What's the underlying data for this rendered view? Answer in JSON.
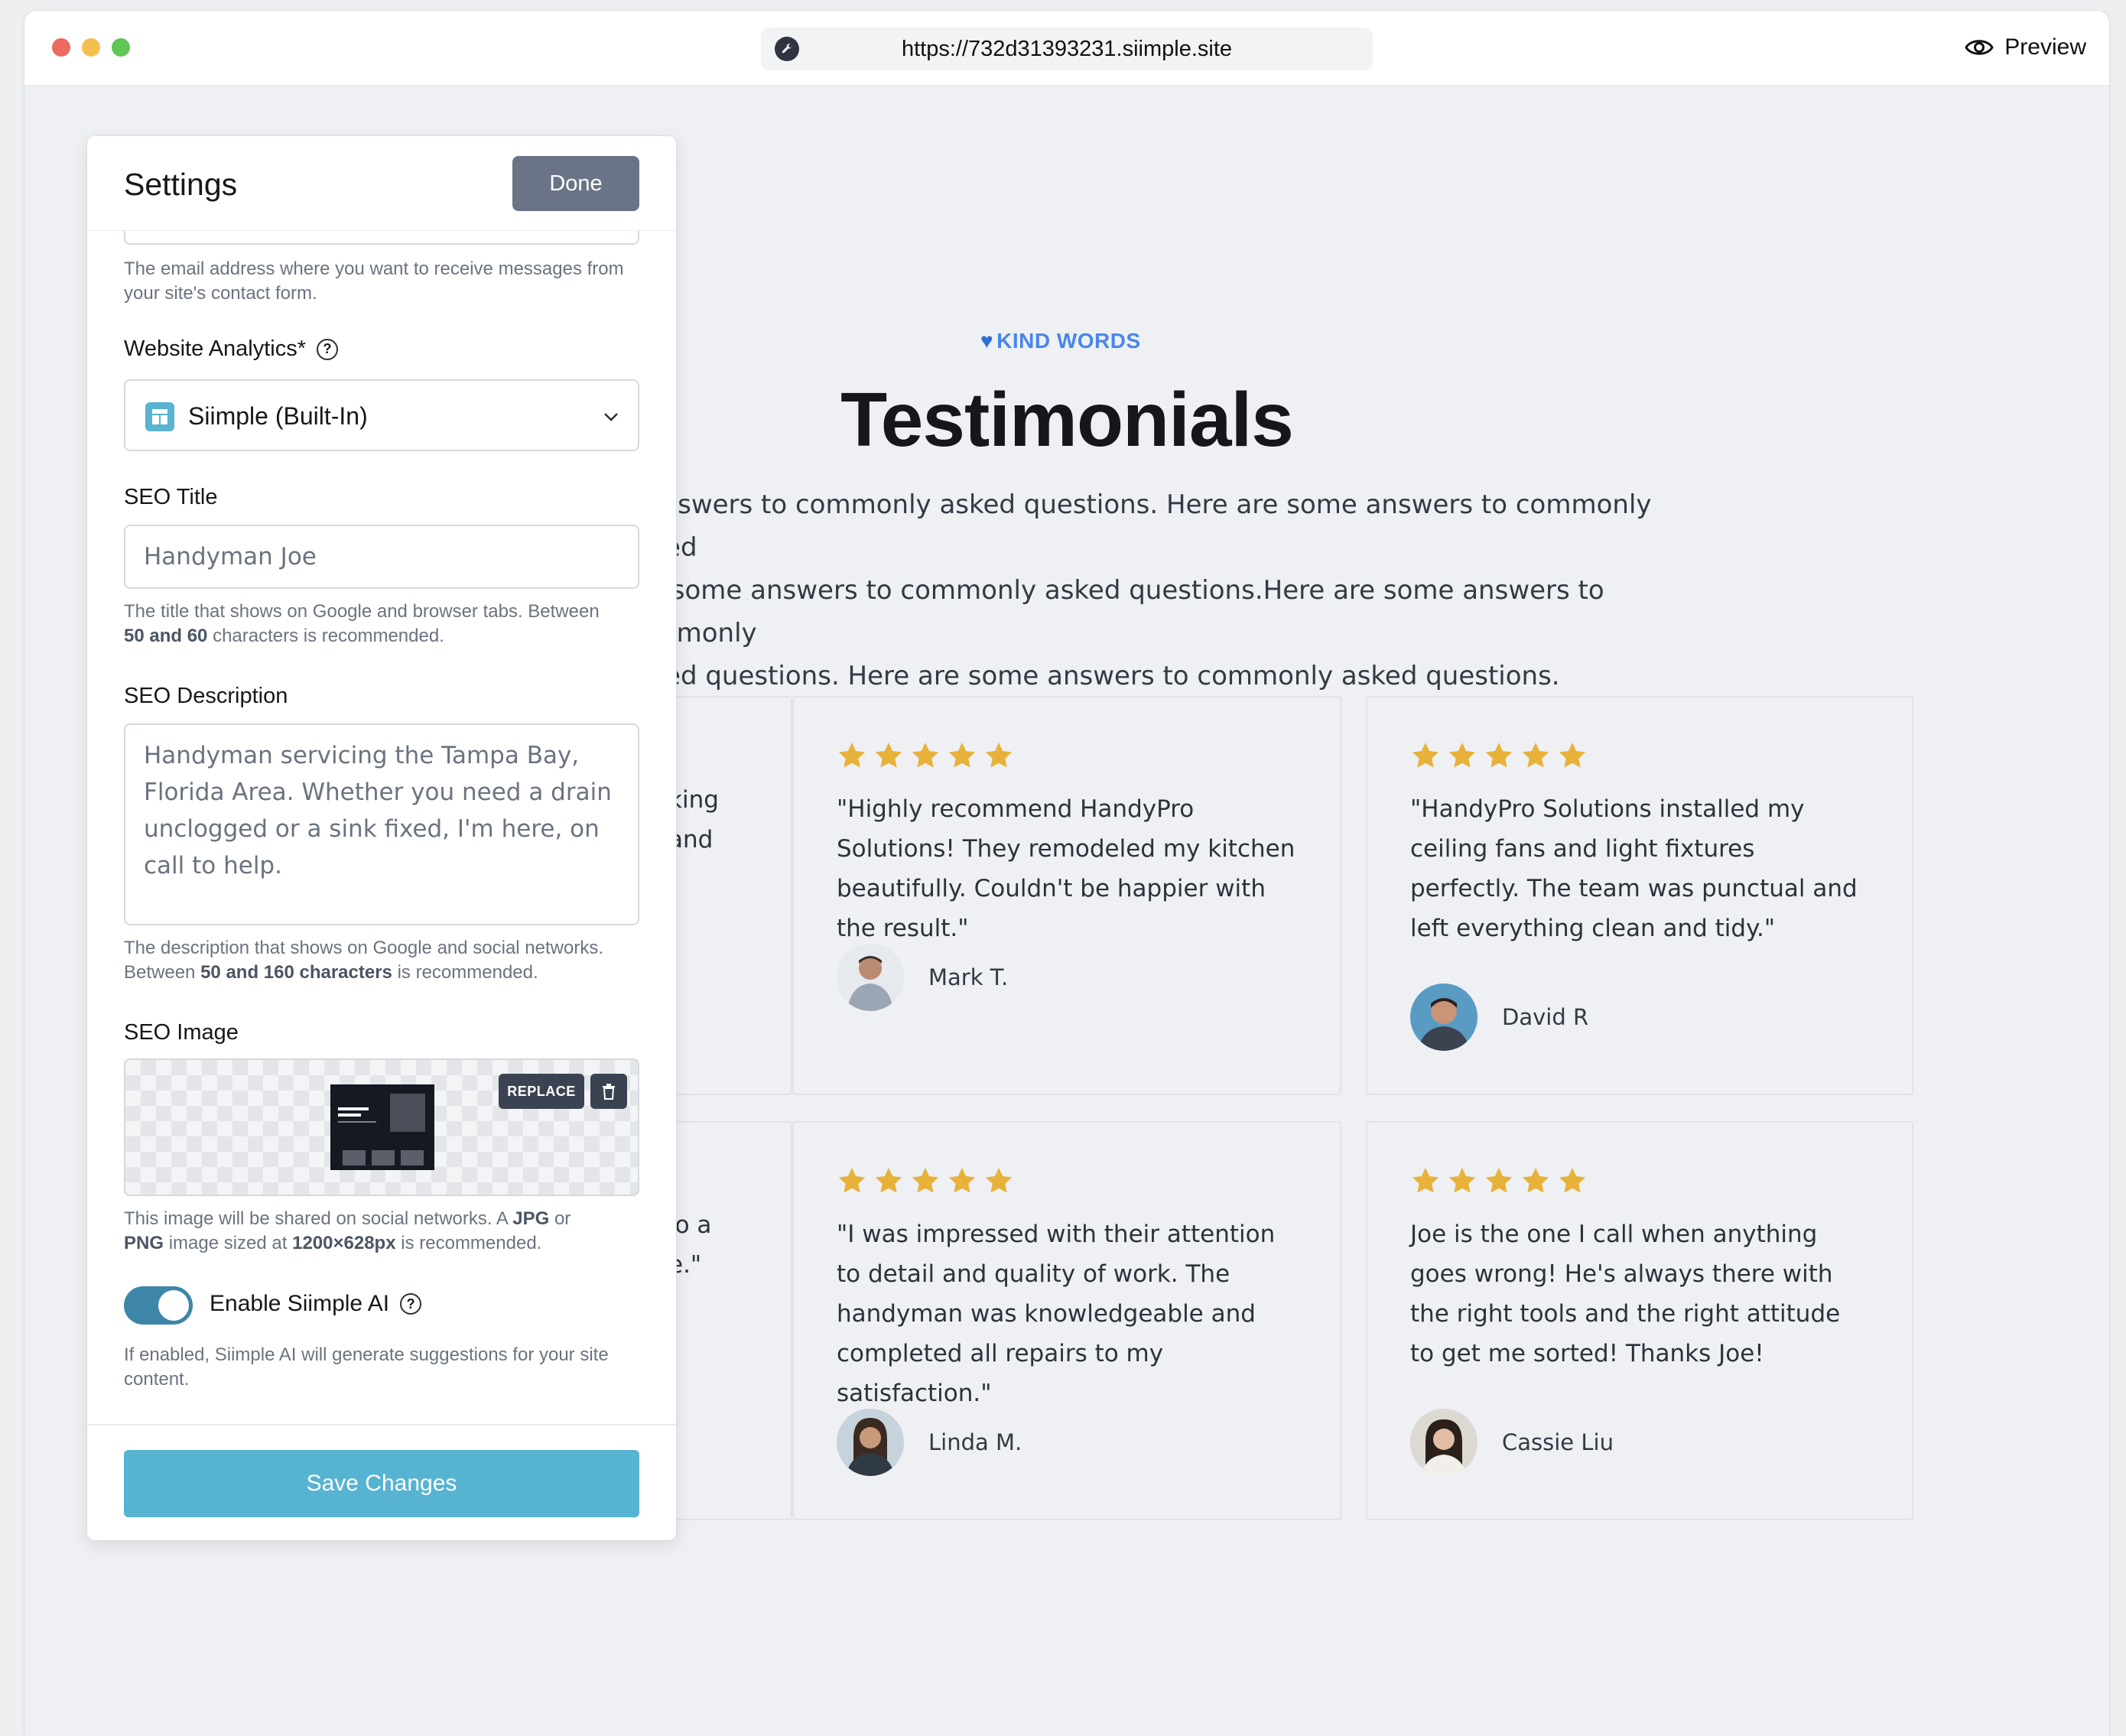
{
  "browser": {
    "url": "https://732d31393231.siimple.site",
    "preview_label": "Preview"
  },
  "settings": {
    "title": "Settings",
    "done_label": "Done",
    "email_help": "The email address where you want to receive messages from your site's contact form.",
    "analytics_label": "Website Analytics*",
    "analytics_value": "Siimple (Built-In)",
    "seo_title_label": "SEO Title",
    "seo_title_value": "Handyman Joe",
    "seo_title_help_1": "The title that shows on Google and browser tabs. Between",
    "seo_title_help_bold": "50 and 60",
    "seo_title_help_2": "characters is recommended.",
    "seo_desc_label": "SEO Description",
    "seo_desc_value": "Handyman servicing the Tampa Bay, Florida Area. Whether you need a drain unclogged or a sink fixed, I'm here, on call to help.",
    "seo_desc_help_1": "The description that shows on Google and social networks. Between",
    "seo_desc_help_bold": "50 and 160 characters",
    "seo_desc_help_2": "is recommended.",
    "seo_image_label": "SEO Image",
    "replace_label": "REPLACE",
    "image_help_1": "This image will be shared on social networks. A",
    "image_help_jpg": "JPG",
    "image_help_or": "or",
    "image_help_png": "PNG",
    "image_help_2": "image sized at",
    "image_help_size": "1200×628px",
    "image_help_3": "is recommended.",
    "ai_label": "Enable Siimple AI",
    "ai_enabled": true,
    "ai_help": "If enabled, Siimple AI will generate suggestions for your site content.",
    "save_label": "Save Changes"
  },
  "page": {
    "eyebrow": "KIND WORDS",
    "eyebrow_icon": "blue-heart-icon",
    "headline": "Testimonials",
    "intro_lines": [
      "e answers to commonly asked questions. Here are some answers to commonly asked",
      "are some answers to commonly asked questions.Here are some answers to commonly",
      "asked questions. Here are some answers to commonly asked questions."
    ],
    "partial_card_1": [
      "king",
      "and"
    ],
    "partial_card_2": [
      "lo a",
      "e.\""
    ],
    "star_color": "#e8b23a",
    "testimonials": [
      {
        "rating": 5,
        "quote": "\"Highly recommend HandyPro Solutions! They remodeled my kitchen beautifully. Couldn't be happier with the result.\"",
        "name": "Mark T."
      },
      {
        "rating": 5,
        "quote": "\"HandyPro Solutions installed my ceiling fans and light fixtures perfectly. The team was punctual and left everything clean and tidy.\"",
        "name": "David R"
      },
      {
        "rating": 5,
        "quote": "\"I was impressed with their attention to detail and quality of work. The handyman was knowledgeable and completed all repairs to my satisfaction.\"",
        "name": "Linda M."
      },
      {
        "rating": 5,
        "quote": "Joe is the one I call when anything goes wrong! He's always there with the right tools and the right attitude to get me sorted! Thanks Joe!",
        "name": "Cassie Liu"
      }
    ]
  }
}
